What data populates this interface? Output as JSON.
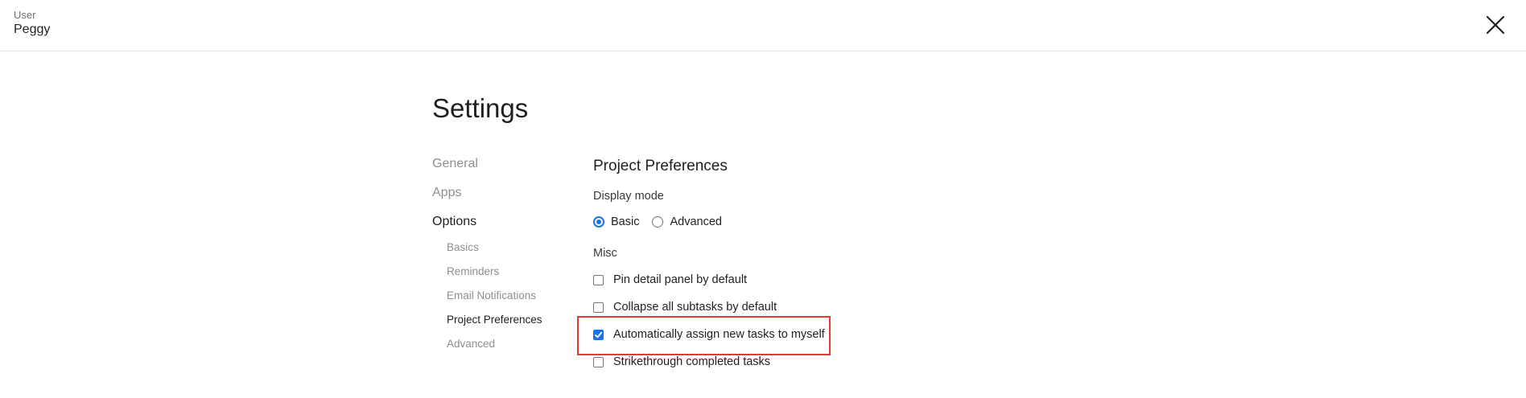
{
  "header": {
    "user_label": "User",
    "user_name": "Peggy",
    "close_icon": "close-icon"
  },
  "settings": {
    "title": "Settings",
    "nav": [
      {
        "label": "General",
        "active": false
      },
      {
        "label": "Apps",
        "active": false
      },
      {
        "label": "Options",
        "active": true
      }
    ],
    "subnav": [
      {
        "label": "Basics",
        "active": false
      },
      {
        "label": "Reminders",
        "active": false
      },
      {
        "label": "Email Notifications",
        "active": false
      },
      {
        "label": "Project Preferences",
        "active": true
      },
      {
        "label": "Advanced",
        "active": false
      }
    ]
  },
  "section": {
    "title": "Project Preferences",
    "display_mode": {
      "label": "Display mode",
      "options": [
        {
          "label": "Basic",
          "checked": true
        },
        {
          "label": "Advanced",
          "checked": false
        }
      ]
    },
    "misc": {
      "label": "Misc",
      "options": [
        {
          "label": "Pin detail panel by default",
          "checked": false
        },
        {
          "label": "Collapse all subtasks by default",
          "checked": false
        },
        {
          "label": "Automatically assign new tasks to myself",
          "checked": true
        },
        {
          "label": "Strikethrough completed tasks",
          "checked": false
        }
      ]
    }
  },
  "colors": {
    "accent": "#1a73e8",
    "highlight": "#e53935",
    "muted": "#8e8e8e"
  }
}
